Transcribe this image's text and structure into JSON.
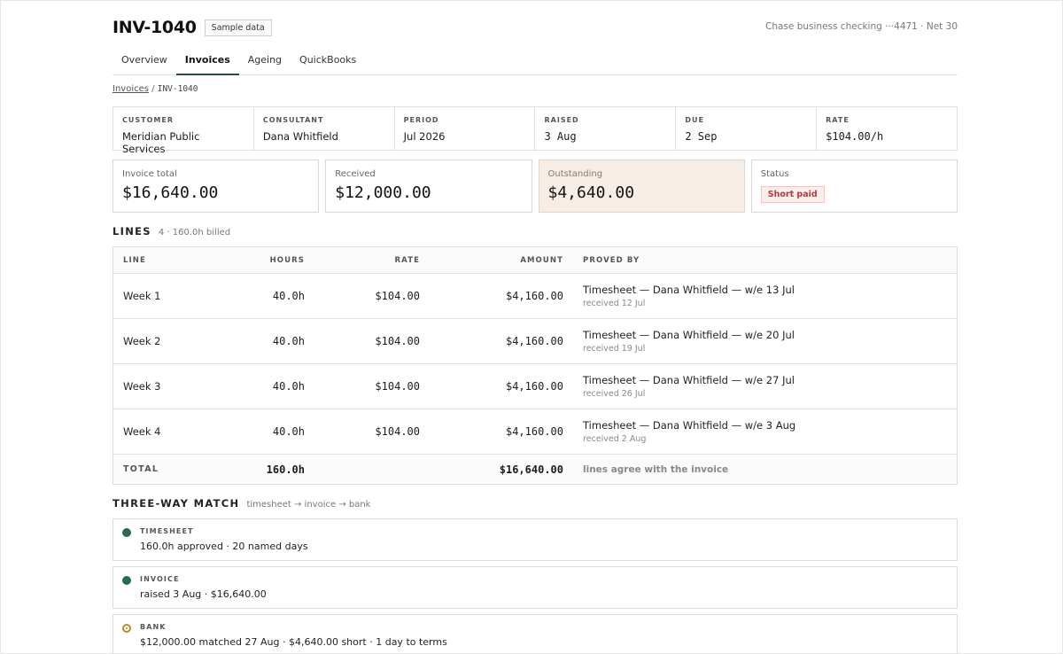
{
  "header": {
    "invoice_id": "INV-1040",
    "sample_badge": "Sample data",
    "account_meta": "Chase business checking ···4471 · Net 30"
  },
  "tabs": [
    {
      "label": "Overview",
      "active": false
    },
    {
      "label": "Invoices",
      "active": true
    },
    {
      "label": "Ageing",
      "active": false
    },
    {
      "label": "QuickBooks",
      "active": false
    }
  ],
  "breadcrumb": {
    "parent": "Invoices",
    "separator": "/",
    "current": "INV-1040"
  },
  "info": {
    "customer": {
      "label": "Customer",
      "value": "Meridian Public Services"
    },
    "consultant": {
      "label": "Consultant",
      "value": "Dana Whitfield"
    },
    "period": {
      "label": "Period",
      "value": "Jul 2026"
    },
    "raised": {
      "label": "Raised",
      "value": "3 Aug"
    },
    "due": {
      "label": "Due",
      "value": "2 Sep"
    },
    "rate": {
      "label": "Rate",
      "value": "$104.00/h"
    }
  },
  "amounts": {
    "invoice_total": {
      "label": "Invoice total",
      "value": "$16,640.00"
    },
    "received": {
      "label": "Received",
      "value": "$12,000.00"
    },
    "outstanding": {
      "label": "Outstanding",
      "value": "$4,640.00"
    },
    "status": {
      "label": "Status",
      "value": "Short paid"
    }
  },
  "lines": {
    "title": "LINES",
    "subtitle": "4 · 160.0h billed",
    "columns": {
      "line": "Line",
      "hours": "Hours",
      "rate": "Rate",
      "amount": "Amount",
      "proved_by": "Proved by"
    },
    "rows": [
      {
        "line": "Week 1",
        "hours": "40.0h",
        "rate": "$104.00",
        "amount": "$4,160.00",
        "proof": "Timesheet — Dana Whitfield — w/e 13 Jul",
        "received": "received 12 Jul"
      },
      {
        "line": "Week 2",
        "hours": "40.0h",
        "rate": "$104.00",
        "amount": "$4,160.00",
        "proof": "Timesheet — Dana Whitfield — w/e 20 Jul",
        "received": "received 19 Jul"
      },
      {
        "line": "Week 3",
        "hours": "40.0h",
        "rate": "$104.00",
        "amount": "$4,160.00",
        "proof": "Timesheet — Dana Whitfield — w/e 27 Jul",
        "received": "received 26 Jul"
      },
      {
        "line": "Week 4",
        "hours": "40.0h",
        "rate": "$104.00",
        "amount": "$4,160.00",
        "proof": "Timesheet — Dana Whitfield — w/e 3 Aug",
        "received": "received 2 Aug"
      }
    ],
    "total": {
      "label": "TOTAL",
      "hours": "160.0h",
      "amount": "$16,640.00",
      "note": "lines agree with the invoice"
    }
  },
  "match": {
    "title": "THREE-WAY MATCH",
    "subtitle": "timesheet → invoice → bank",
    "items": [
      {
        "label": "TIMESHEET",
        "value": "160.0h approved · 20 named days",
        "state": "ok"
      },
      {
        "label": "INVOICE",
        "value": "raised 3 Aug · $16,640.00",
        "state": "ok"
      },
      {
        "label": "BANK",
        "value": "$12,000.00 matched 27 Aug · $4,640.00 short · 1 day to terms",
        "state": "warn"
      }
    ]
  },
  "colors": {
    "accent": "#2b4b44",
    "ok": "#2a6a4f",
    "warn": "#b88a2e",
    "outstanding_bg": "#f5ede6",
    "status_red": "#b43a3a"
  }
}
